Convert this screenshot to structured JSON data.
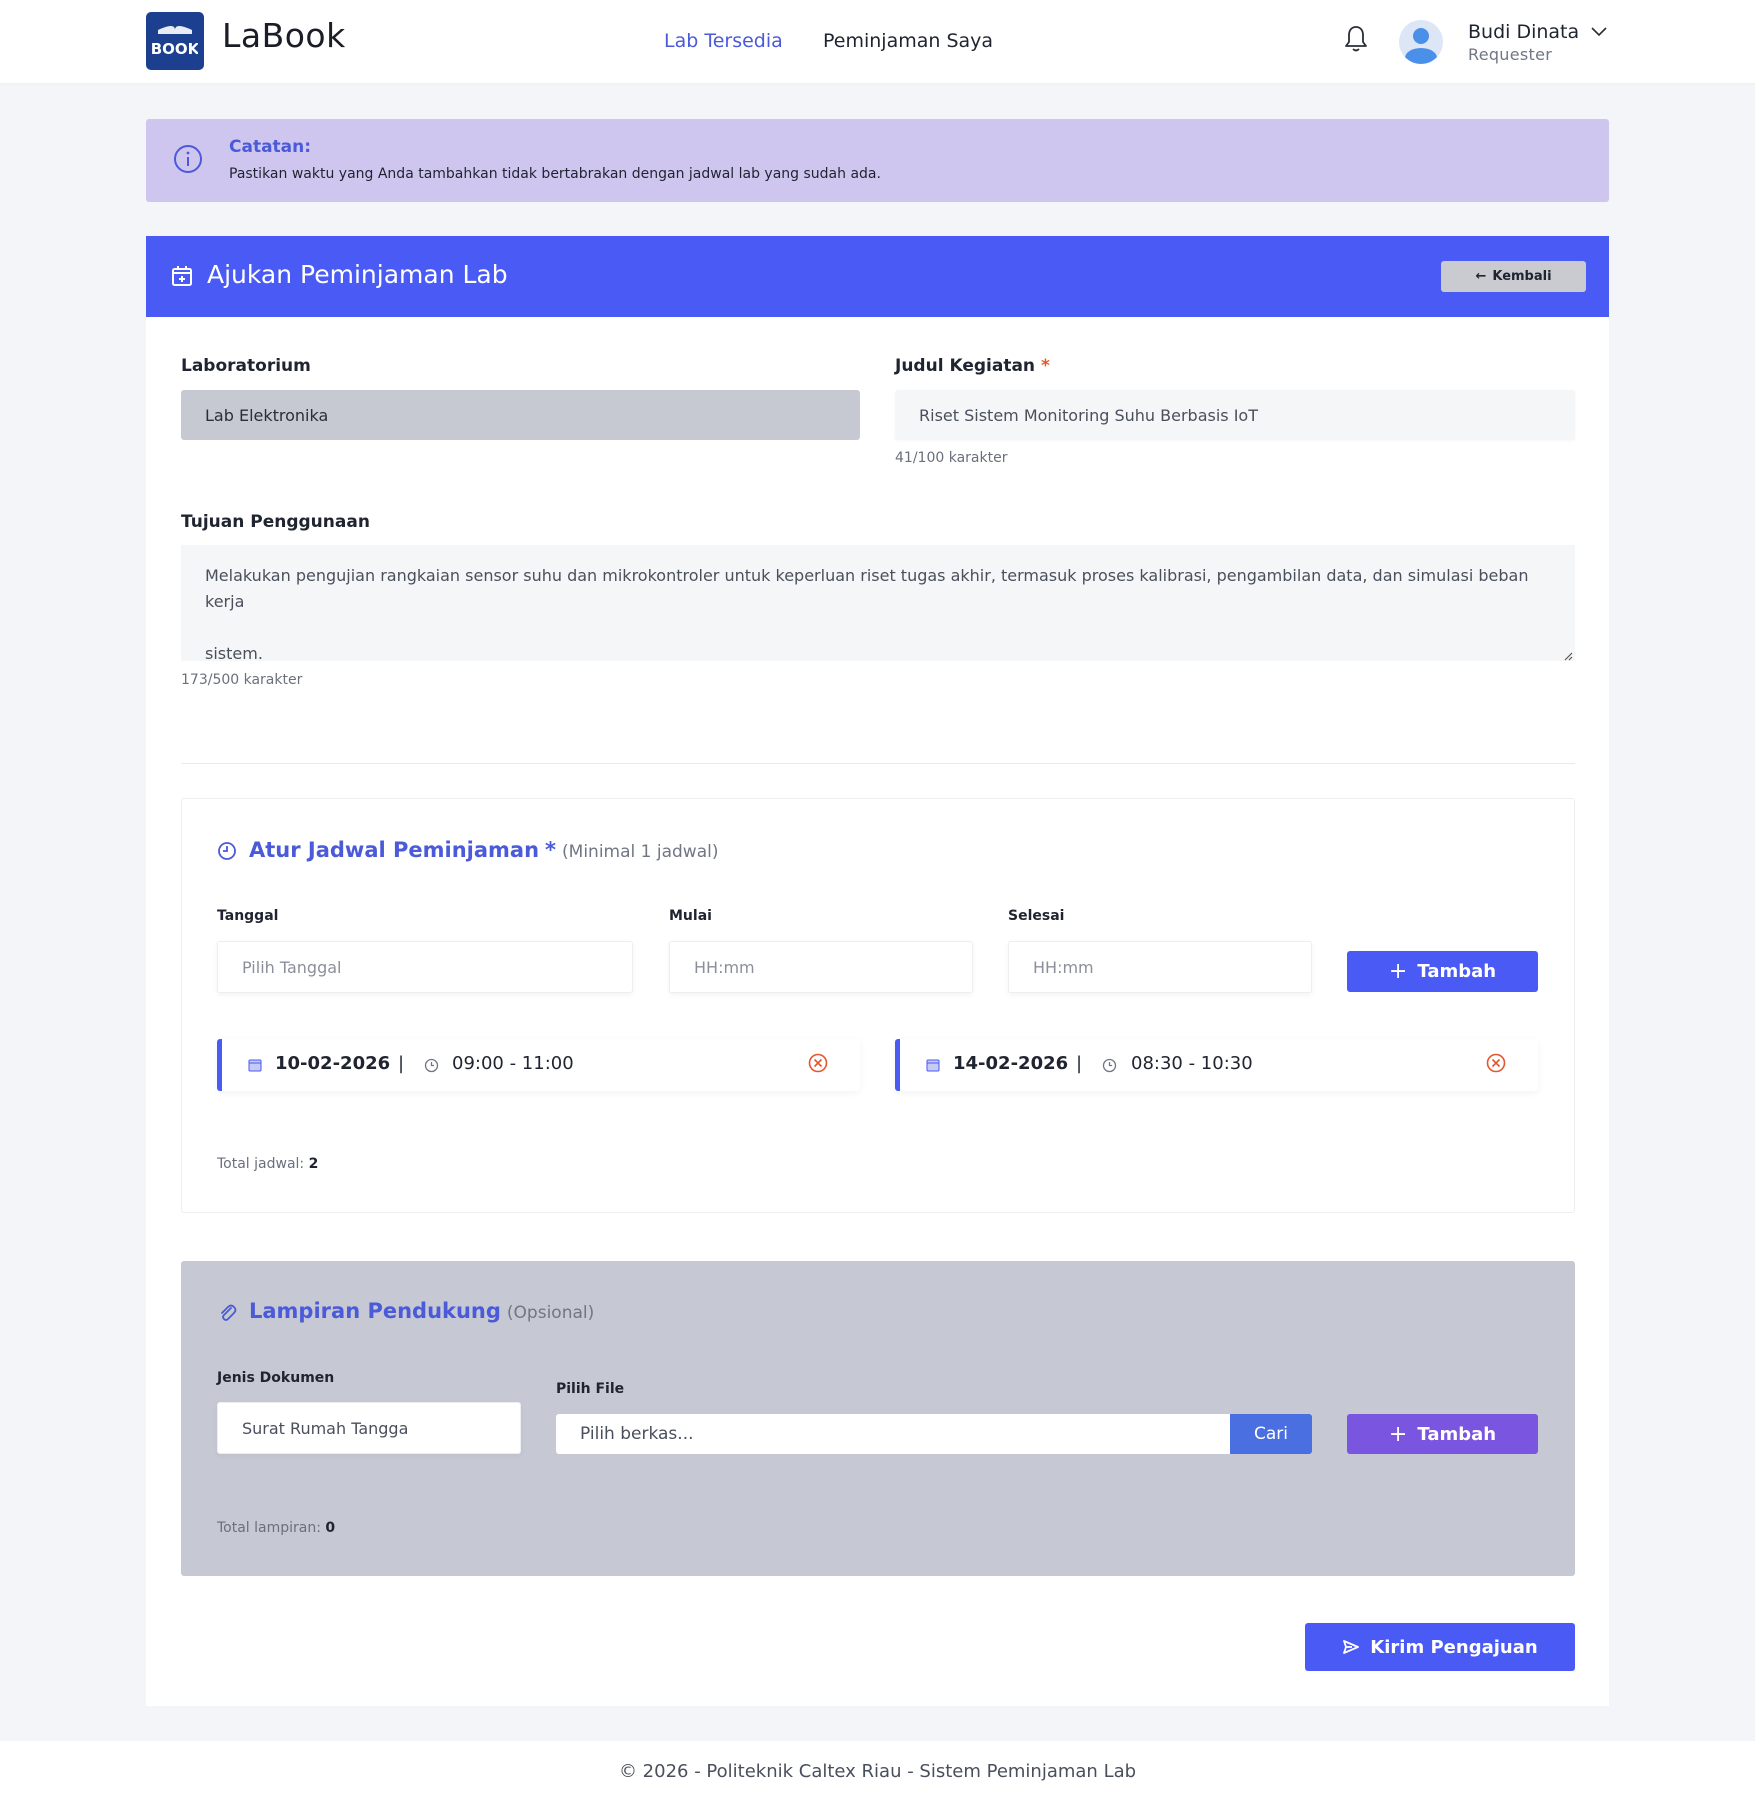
{
  "navbar": {
    "logo_text": "BOOK",
    "brand": "LaBook",
    "links": [
      "Lab Tersedia",
      "Peminjaman Saya"
    ],
    "user_name": "Budi Dinata",
    "user_role": "Requester",
    "icons": {
      "notification": "bell-icon",
      "profile": "avatar",
      "menu": "chevron-down-icon"
    }
  },
  "note": {
    "title": "Catatan:",
    "text": "Pastikan waktu yang Anda tambahkan tidak bertabrakan dengan jadwal lab yang sudah ada."
  },
  "card": {
    "title": "Ajukan Peminjaman Lab",
    "back_label": "Kembali"
  },
  "form": {
    "lab_label": "Laboratorium",
    "lab_value": "Lab Elektronika",
    "judul_label": "Judul Kegiatan",
    "judul_value": "Riset Sistem Monitoring Suhu Berbasis IoT",
    "judul_count": "41/100 karakter",
    "tujuan_label": "Tujuan Penggunaan",
    "tujuan_value_line1": "Melakukan pengujian rangkaian sensor suhu dan mikrokontroler untuk keperluan riset tugas akhir, termasuk proses kalibrasi, pengambilan data, dan simulasi beban kerja",
    "tujuan_value_line2": "sistem.",
    "tujuan_count": "173/500 karakter",
    "required_mark": "*"
  },
  "schedule": {
    "title": "Atur Jadwal Peminjaman",
    "subtitle": "(Minimal 1 jadwal)",
    "tanggal_label": "Tanggal",
    "tanggal_placeholder": "Pilih Tanggal",
    "mulai_label": "Mulai",
    "mulai_placeholder": "HH:mm",
    "selesai_label": "Selesai",
    "selesai_placeholder": "HH:mm",
    "add_label": "Tambah",
    "items": [
      {
        "date": "10-02-2026",
        "time": "09:00 - 11:00"
      },
      {
        "date": "14-02-2026",
        "time": "08:30 - 10:30"
      }
    ],
    "separator": "|",
    "total_label": "Total jadwal:",
    "total_value": "2"
  },
  "attachment": {
    "title": "Lampiran Pendukung",
    "subtitle": "(Opsional)",
    "jenis_label": "Jenis Dokumen",
    "jenis_value": "Surat Rumah Tangga",
    "file_label": "Pilih File",
    "file_placeholder": "Pilih berkas...",
    "browse_label": "Cari",
    "add_label": "Tambah",
    "total_label": "Total lampiran:",
    "total_value": "0"
  },
  "submit_label": "Kirim Pengajuan",
  "footer": "© 2026 - Politeknik Caltex Riau - Sistem Peminjaman Lab",
  "colors": {
    "primary": "#4a5af5",
    "accent_text": "#4a5ad8",
    "note_bg": "#cfc6f0",
    "purple": "#7a55e0",
    "danger": "#e4572e"
  }
}
